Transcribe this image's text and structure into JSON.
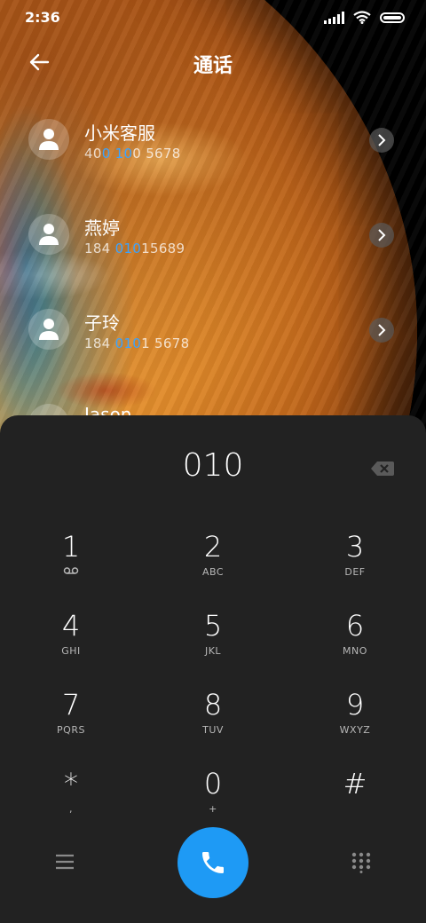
{
  "status_bar": {
    "time": "2:36",
    "icons": [
      "signal-icon",
      "wifi-icon",
      "battery-icon"
    ]
  },
  "header": {
    "title": "通话",
    "back_icon": "arrow-left-icon"
  },
  "contacts": [
    {
      "name": "小米客服",
      "number_parts": [
        "40",
        "0 10",
        "0 5678"
      ]
    },
    {
      "name": "燕婷",
      "number_parts": [
        "184 ",
        "010",
        "15689"
      ]
    },
    {
      "name": "子玲",
      "number_parts": [
        "184 ",
        "010",
        "1 5678"
      ]
    },
    {
      "name": "Jason",
      "number_parts": [
        "",
        "",
        ""
      ]
    }
  ],
  "dialer": {
    "input_value": "010",
    "keys": [
      {
        "digit": "1",
        "letters": "",
        "icon": "voicemail-icon"
      },
      {
        "digit": "2",
        "letters": "ABC"
      },
      {
        "digit": "3",
        "letters": "DEF"
      },
      {
        "digit": "4",
        "letters": "GHI"
      },
      {
        "digit": "5",
        "letters": "JKL"
      },
      {
        "digit": "6",
        "letters": "MNO"
      },
      {
        "digit": "7",
        "letters": "PQRS"
      },
      {
        "digit": "8",
        "letters": "TUV"
      },
      {
        "digit": "9",
        "letters": "WXYZ"
      },
      {
        "digit": "*",
        "letters": ","
      },
      {
        "digit": "0",
        "letters": "+"
      },
      {
        "digit": "#",
        "letters": ""
      }
    ]
  },
  "colors": {
    "accent": "#1e9af5",
    "highlight": "#3aa3ff",
    "panel": "#222222"
  }
}
